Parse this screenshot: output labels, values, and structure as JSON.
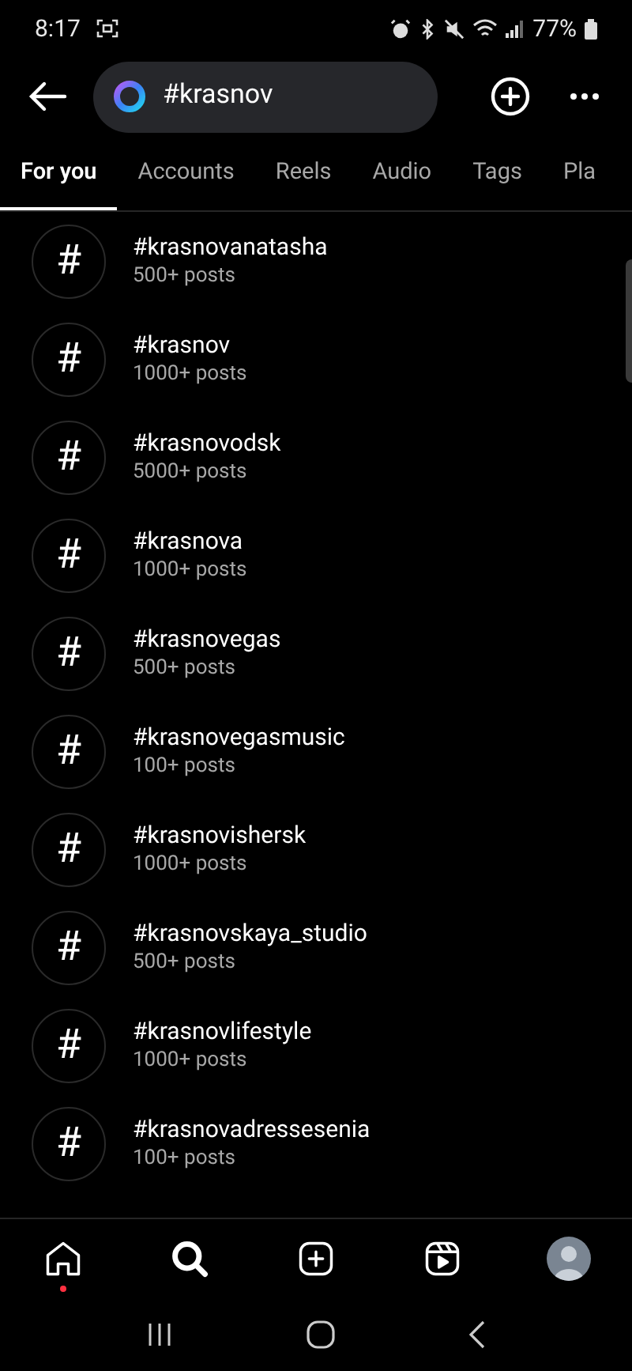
{
  "status_bar": {
    "time": "8:17",
    "battery": "77%"
  },
  "search": {
    "value": "#krasnov"
  },
  "tabs": [
    {
      "label": "For you",
      "selected": true
    },
    {
      "label": "Accounts",
      "selected": false
    },
    {
      "label": "Reels",
      "selected": false
    },
    {
      "label": "Audio",
      "selected": false
    },
    {
      "label": "Tags",
      "selected": false
    },
    {
      "label": "Pla",
      "selected": false
    }
  ],
  "results": [
    {
      "symbol": "#",
      "name": "#krasnovanatasha",
      "count": "500+ posts"
    },
    {
      "symbol": "#",
      "name": "#krasnov",
      "count": "1000+ posts"
    },
    {
      "symbol": "#",
      "name": "#krasnovodsk",
      "count": "5000+ posts"
    },
    {
      "symbol": "#",
      "name": "#krasnova",
      "count": "1000+ posts"
    },
    {
      "symbol": "#",
      "name": "#krasnovegas",
      "count": "500+ posts"
    },
    {
      "symbol": "#",
      "name": "#krasnovegasmusic",
      "count": "100+ posts"
    },
    {
      "symbol": "#",
      "name": "#krasnovishersk",
      "count": "1000+ posts"
    },
    {
      "symbol": "#",
      "name": "#krasnovskaya_studio",
      "count": "500+ posts"
    },
    {
      "symbol": "#",
      "name": "#krasnovlifestyle",
      "count": "1000+ posts"
    },
    {
      "symbol": "#",
      "name": "#krasnovadressesenia",
      "count": "100+ posts"
    }
  ],
  "bottom_nav": [
    {
      "kind": "home",
      "selected": false,
      "badge": true
    },
    {
      "kind": "search",
      "selected": true,
      "badge": false
    },
    {
      "kind": "create",
      "selected": false,
      "badge": false
    },
    {
      "kind": "reels",
      "selected": false,
      "badge": false
    },
    {
      "kind": "profile",
      "selected": false,
      "badge": false
    }
  ]
}
